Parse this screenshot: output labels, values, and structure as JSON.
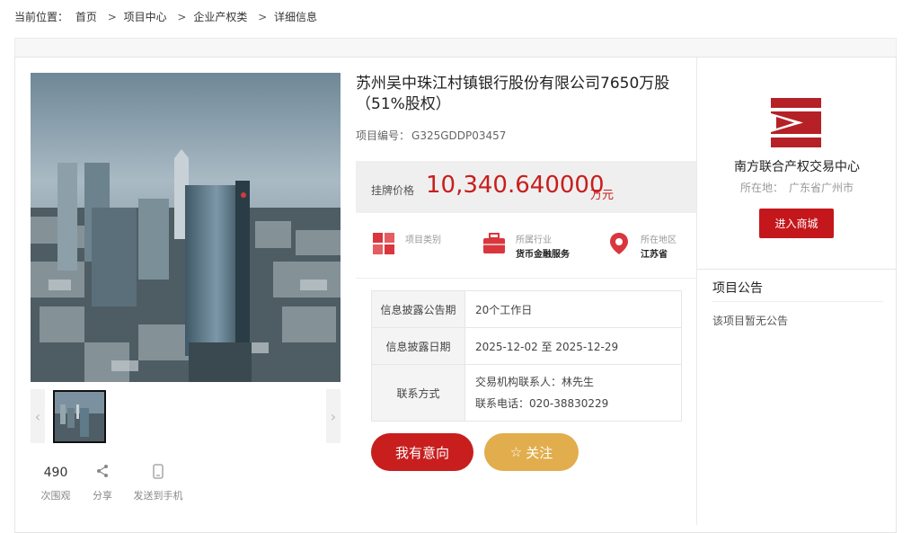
{
  "breadcrumb": {
    "label": "当前位置：",
    "items": [
      "首页",
      "项目中心",
      "企业产权类",
      "详细信息"
    ],
    "separator": ">"
  },
  "project": {
    "title": "苏州吴中珠江村镇银行股份有限公司7650万股（51%股权）",
    "code_label": "项目编号：",
    "code_value": "G325GDDP03457",
    "price_label": "挂牌价格",
    "price_value": "10,340.640000",
    "price_unit": "万元"
  },
  "categories": [
    {
      "label": "项目类别",
      "value": "",
      "icon": "grid-icon",
      "color": "#d9363e"
    },
    {
      "label": "所属行业",
      "value": "货币金融服务",
      "icon": "briefcase-icon",
      "color": "#d9363e"
    },
    {
      "label": "所在地区",
      "value": "江苏省",
      "icon": "location-pin-icon",
      "color": "#d9363e"
    }
  ],
  "info": {
    "period_label": "信息披露公告期",
    "period_value": "20个工作日",
    "date_label": "信息披露日期",
    "date_value": "2025-12-02 至 2025-12-29",
    "contact_label": "联系方式",
    "contact_person": "交易机构联系人：林先生",
    "contact_phone": "联系电话：020-38830229"
  },
  "actions": {
    "intent": "我有意向",
    "follow": "关注"
  },
  "stats": {
    "views_count": "490",
    "views_label": "次围观",
    "share_label": "分享",
    "send_label": "发送到手机"
  },
  "org": {
    "name": "南方联合产权交易中心",
    "loc_label": "所在地：",
    "loc_value": "广东省广州市",
    "store_button": "进入商城",
    "brand_color": "#b52126"
  },
  "notice": {
    "title": "项目公告",
    "text": "该项目暂无公告"
  },
  "colors": {
    "accent_red": "#c81e1e",
    "follow_gold": "#e2ad4d"
  }
}
